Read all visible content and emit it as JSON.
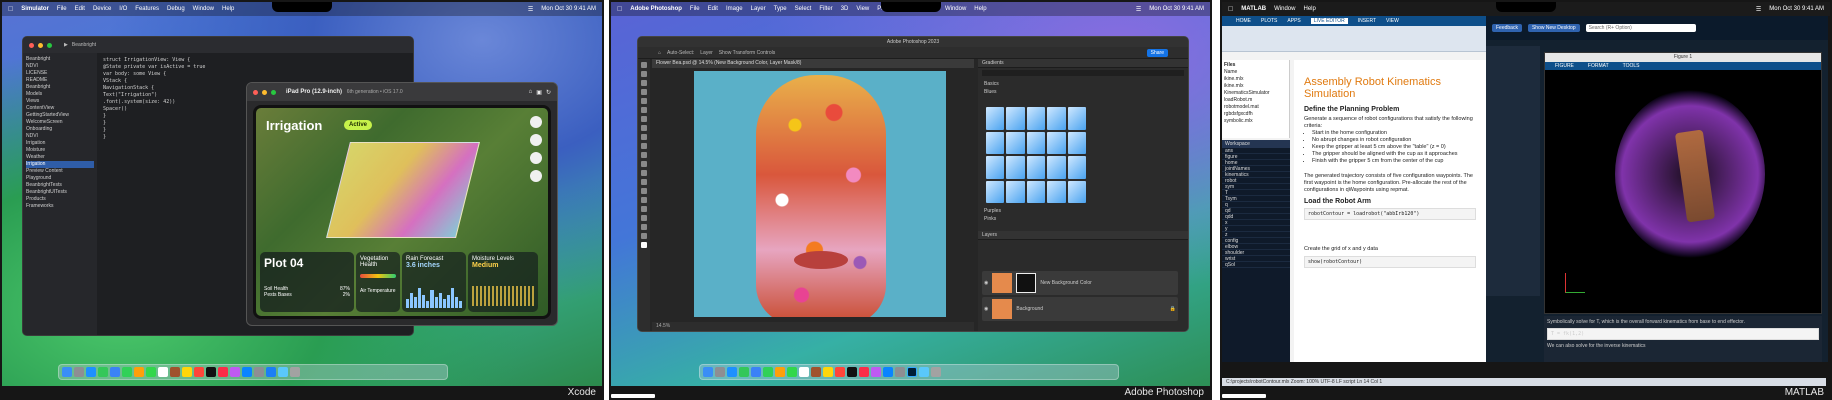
{
  "panels": {
    "xcode": {
      "caption": "Xcode",
      "menu": {
        "app": "Simulator",
        "items": [
          "File",
          "Edit",
          "Device",
          "I/O",
          "Features",
          "Debug",
          "Window",
          "Help"
        ],
        "clock": "Mon Oct 30  9:41 AM"
      },
      "navigator": [
        "Beanbright",
        "NDVI",
        "LICENSE",
        "README",
        "Beanbright",
        "Models",
        "Views",
        "ContentView",
        "GettingStartedView",
        "WelcomeScreen",
        "Onboarding",
        "NDVI",
        "Irrigation",
        "Moisture",
        "Weather",
        "Irrigation",
        "Preview Content",
        "Playground",
        "BeanbrightTests",
        "BeanbrightUITests",
        "Products",
        "Frameworks"
      ],
      "code": [
        "struct IrrigationView: View {",
        "  @State private var isActive = true",
        "  var body: some View {",
        "    VStack {",
        "      NavigationStack {",
        "        Text(\"Irrigation\")",
        "          .font(.system(size: 42))",
        "        Spacer()",
        "      }",
        "    }",
        "  }",
        "}"
      ],
      "sim_title": "iPad Pro (12.9-inch)",
      "sim_sub": "6th generation • iOS 17.0",
      "app": {
        "title": "Irrigation",
        "badge": "Active",
        "plot": "Plot 04",
        "veg_label": "Vegetation Health",
        "rain_label": "Rain Forecast",
        "rain_value": "3.6 inches",
        "moist_label": "Moisture Levels",
        "moist_value": "Medium",
        "soil_label": "Soil Health",
        "soil_value": "87%",
        "pests_label": "Pests Bases",
        "pests_value": "2%",
        "temp_label": "Air Temperature",
        "rain_bars": [
          0.4,
          0.7,
          0.5,
          0.9,
          0.6,
          0.3,
          0.8,
          0.5,
          0.7,
          0.4,
          0.6,
          0.9,
          0.5,
          0.3
        ]
      }
    },
    "photoshop": {
      "caption": "Adobe Photoshop",
      "menu": {
        "app": "Adobe Photoshop",
        "items": [
          "File",
          "Edit",
          "Image",
          "Layer",
          "Type",
          "Select",
          "Filter",
          "3D",
          "View",
          "Plugins",
          "Window",
          "Help"
        ],
        "clock": "Mon Oct 30  9:41 AM"
      },
      "window_title": "Adobe Photoshop 2023",
      "options": [
        "Auto-Select:",
        "Layer",
        "Show Transform Controls"
      ],
      "share": "Share",
      "doc_tab": "Flower Bea.psd @ 14.5% (New Background Color, Layer Mask/8)",
      "status": "14.5%",
      "gradients_hdr": "Gradients",
      "groups": [
        "Basics",
        "Blues",
        "Purples",
        "Pinks"
      ],
      "layers_hdr": "Layers",
      "layers": [
        "New Background Color",
        "Background"
      ]
    },
    "matlab": {
      "caption": "MATLAB",
      "menu": {
        "app": "MATLAB",
        "items": [
          "Window",
          "Help"
        ],
        "clock": "Mon Oct 30  9:41 AM"
      },
      "tabs": [
        "HOME",
        "PLOTS",
        "APPS",
        "LIVE EDITOR",
        "INSERT",
        "VIEW"
      ],
      "files": [
        "Files",
        "Name",
        "ikine.mlx",
        "ikine.mlx",
        "KinematicsSimulator",
        "loadRobot.m",
        "robotmodel.mat",
        "rgbdsfgxcdfh",
        "symbolic.mlx"
      ],
      "workspace_hdr": "Workspace",
      "workspace": [
        "ans",
        "figure",
        "home",
        "jointNames",
        "kinematics",
        "robot",
        "sym",
        "T",
        "Tsym",
        "q",
        "qd",
        "qdd",
        "x",
        "y",
        "z",
        "config",
        "elbow",
        "shoulder",
        "wrist",
        "qSol"
      ],
      "doc": {
        "title": "Assembly Robot Kinematics Simulation",
        "h_plan": "Define the Planning Problem",
        "p1": "Generate a sequence of robot configurations that satisfy the following criteria:",
        "bullets": [
          "Start in the home configuration",
          "No abrupt changes in robot configuration",
          "Keep the gripper at least 5 cm above the \"table\" (z = 0)",
          "The gripper should be aligned with the cup as it approaches",
          "Finish with the gripper 5 cm from the center of the cup"
        ],
        "p2": "The generated trajectory consists of five configuration waypoints. The first waypoint is the home configuration. Pre-allocate the rest of the configurations in qWaypoints using repmat.",
        "h_load": "Load the Robot Arm",
        "code1": "robotContour = loadrobot(\"abbIrb120\")",
        "code2": "show(robotContour)",
        "p3": "Create the grid of x and y data"
      },
      "figure_title": "Figure 1",
      "figure_tabs": [
        "FIGURE",
        "FORMAT",
        "TOOLS"
      ],
      "topbar": [
        "Feedback",
        "Show New Desktop"
      ],
      "search": "Search (R+ Option)",
      "lower": [
        "Symbolically solve for T, which is the overall forward kinematics from base to end effector.",
        "T = fk(1,2)",
        "We can also solve for the inverse kinematics",
        "ik = fun(ink,ikine_sym(2))"
      ],
      "status": "C:\\projects\\robotContour.mlx   Zoom: 100%   UTF-8   LF   script   Ln 14  Col 1"
    }
  }
}
